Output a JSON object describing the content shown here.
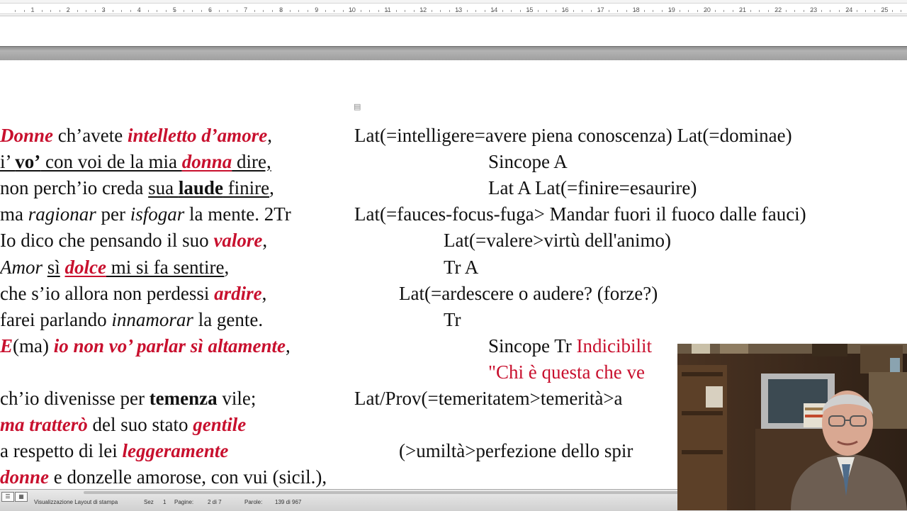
{
  "ruler": {
    "numbers": [
      "1",
      "2",
      "3",
      "4",
      "5",
      "6",
      "7",
      "8",
      "9",
      "10",
      "11",
      "12",
      "13",
      "14",
      "15",
      "16",
      "17",
      "18",
      "19",
      "20",
      "21",
      "22",
      "23",
      "24",
      "25"
    ]
  },
  "left_column": [
    [
      {
        "t": "Donne",
        "s": "ri"
      },
      {
        "t": " ch’avete "
      },
      {
        "t": "intelletto d’amore",
        "s": "ri"
      },
      {
        "t": ","
      }
    ],
    [
      {
        "t": "i’ ",
        "s": "u"
      },
      {
        "t": "vo’",
        "s": "b u"
      },
      {
        "t": " con voi de la mia ",
        "s": "u"
      },
      {
        "t": "donna",
        "s": "ri u"
      },
      {
        "t": " dire,",
        "s": "u"
      }
    ],
    [
      {
        "t": "non perch’io creda "
      },
      {
        "t": "sua ",
        "s": "u"
      },
      {
        "t": "laude",
        "s": "b u"
      },
      {
        "t": " finire",
        "s": "u"
      },
      {
        "t": ","
      }
    ],
    [
      {
        "t": "ma "
      },
      {
        "t": "ragionar",
        "s": "i"
      },
      {
        "t": " per "
      },
      {
        "t": "isfogar",
        "s": "i"
      },
      {
        "t": " la mente. 2Tr"
      }
    ],
    [
      {
        "t": "Io dico che pensando il suo "
      },
      {
        "t": "valore",
        "s": "ri"
      },
      {
        "t": ","
      }
    ],
    [
      {
        "t": "Amor",
        "s": "i"
      },
      {
        "t": " "
      },
      {
        "t": "sì",
        "s": "u"
      },
      {
        "t": " "
      },
      {
        "t": "dolce",
        "s": "ri u"
      },
      {
        "t": " mi si fa sentire",
        "s": "u"
      },
      {
        "t": ","
      }
    ],
    [
      {
        "t": "che s’io allora non perdessi "
      },
      {
        "t": "ardire",
        "s": "ri"
      },
      {
        "t": ","
      }
    ],
    [
      {
        "t": "farei parlando "
      },
      {
        "t": "innamorar",
        "s": "i"
      },
      {
        "t": " la gente."
      }
    ],
    [
      {
        "t": "E",
        "s": "ri"
      },
      {
        "t": "(ma) "
      },
      {
        "t": "io non vo’ parlar sì altamente",
        "s": "ri"
      },
      {
        "t": ","
      }
    ],
    [],
    [
      {
        "t": "ch’io divenisse per "
      },
      {
        "t": "temenza",
        "s": "b"
      },
      {
        "t": " vile;"
      }
    ],
    [
      {
        "t": "ma tratterò",
        "s": "ri"
      },
      {
        "t": " del suo stato "
      },
      {
        "t": "gentile",
        "s": "ri"
      }
    ],
    [
      {
        "t": "a respetto di lei "
      },
      {
        "t": "leggeramente",
        "s": "ri"
      }
    ],
    [
      {
        "t": "donne",
        "s": "ri"
      },
      {
        "t": " e donzelle amorose, con vui (sicil.),"
      }
    ]
  ],
  "right_column": [
    {
      "indent": 500,
      "parts": [
        {
          "t": "Lat(=intelligere=avere piena conoscenza) Lat(=dominae)"
        }
      ]
    },
    {
      "indent": 689,
      "parts": [
        {
          "t": "Sincope  A"
        }
      ]
    },
    {
      "indent": 689,
      "parts": [
        {
          "t": "Lat  A  Lat(=finire=esaurire)"
        }
      ]
    },
    {
      "indent": 500,
      "parts": [
        {
          "t": "Lat(=fauces-focus-fuga> Mandar fuori il fuoco dalle fauci)"
        }
      ]
    },
    {
      "indent": 626,
      "parts": [
        {
          "t": "Lat(=valere>virtù dell'animo)"
        }
      ]
    },
    {
      "indent": 626,
      "parts": [
        {
          "t": "Tr  A"
        }
      ]
    },
    {
      "indent": 563,
      "parts": [
        {
          "t": "Lat(=ardescere o audere? (forze?)"
        }
      ]
    },
    {
      "indent": 626,
      "parts": [
        {
          "t": "Tr"
        }
      ]
    },
    {
      "indent": 689,
      "parts": [
        {
          "t": "Sincope  Tr  "
        },
        {
          "t": "Indicibilit",
          "s": "red"
        }
      ]
    },
    {
      "indent": 689,
      "parts": [
        {
          "t": "\"Chi è questa che ve",
          "s": "red"
        }
      ]
    },
    {
      "indent": 500,
      "parts": [
        {
          "t": "Lat/Prov(=temeritatem>temerità>a"
        }
      ]
    },
    {
      "indent": 0,
      "parts": []
    },
    {
      "indent": 563,
      "parts": [
        {
          "t": "(>umiltà>perfezione dello spir"
        }
      ]
    },
    {
      "indent": 0,
      "parts": []
    }
  ],
  "status_bar": {
    "view_label": "Visualizzazione Layout di stampa",
    "section_label": "Sez",
    "section_value": "1",
    "pages_label": "Pagine:",
    "pages_value": "2 di 7",
    "words_label": "Parole:",
    "words_value": "139 di 967"
  },
  "colors": {
    "accent_red": "#c8102e",
    "text": "#111111",
    "gap_gray": "#a0a0a0"
  }
}
